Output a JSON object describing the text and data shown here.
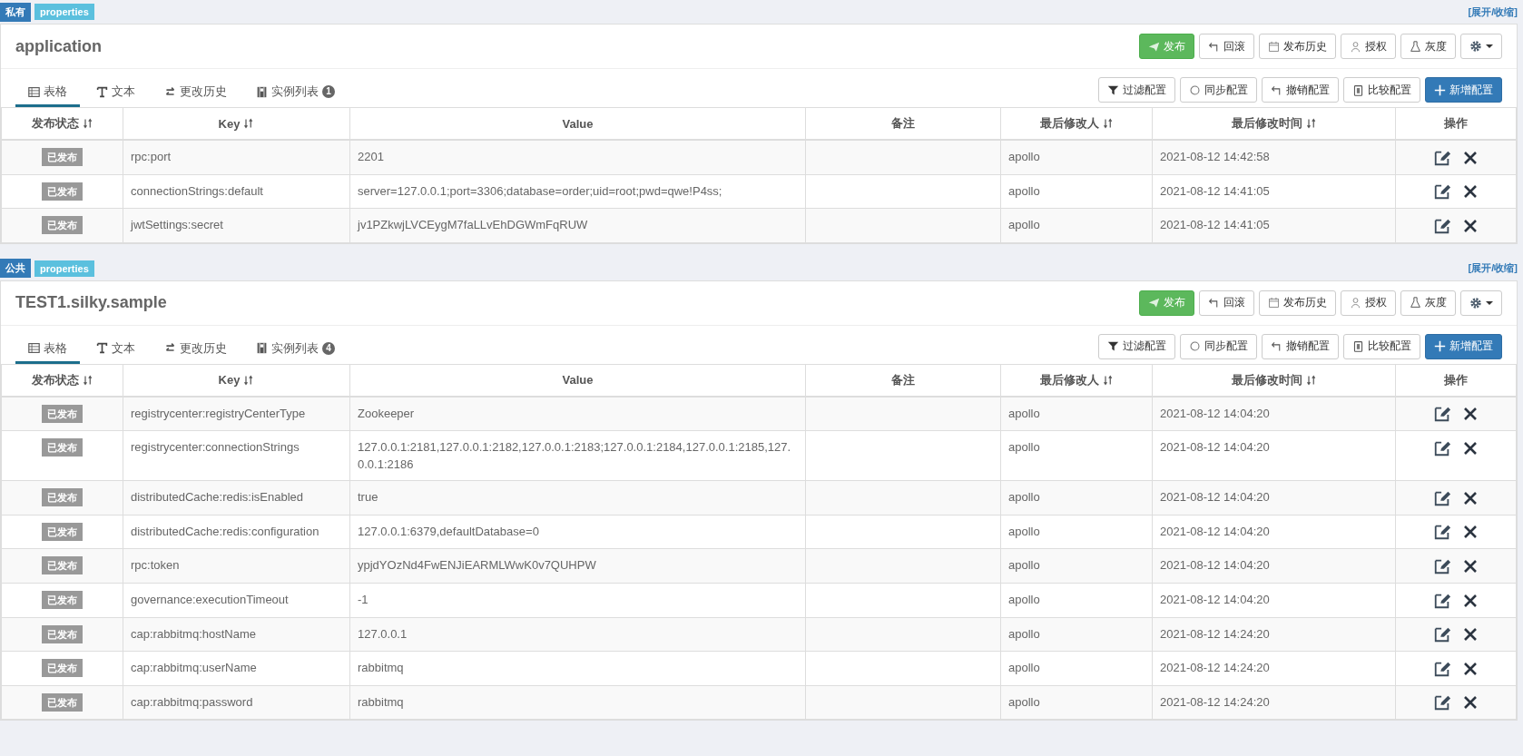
{
  "sections": [
    {
      "scope_badge": "私有",
      "format_badge": "properties",
      "toggle_link": "[展开/收缩]",
      "title": "application",
      "actions": [
        {
          "label": "发布",
          "kind": "publish"
        },
        {
          "label": "回滚",
          "kind": "rollback"
        },
        {
          "label": "发布历史",
          "kind": "history"
        },
        {
          "label": "授权",
          "kind": "grant"
        },
        {
          "label": "灰度",
          "kind": "canary"
        }
      ],
      "tabs": [
        {
          "label": "表格",
          "kind": "table",
          "selected": true
        },
        {
          "label": "文本",
          "kind": "text",
          "selected": false
        },
        {
          "label": "更改历史",
          "kind": "changes",
          "selected": false
        },
        {
          "label": "实例列表",
          "kind": "instances",
          "badge": "1",
          "selected": false
        }
      ],
      "table_actions": [
        {
          "label": "过滤配置",
          "kind": "filter"
        },
        {
          "label": "同步配置",
          "kind": "sync"
        },
        {
          "label": "撤销配置",
          "kind": "revoke"
        },
        {
          "label": "比较配置",
          "kind": "compare"
        },
        {
          "label": "新增配置",
          "kind": "add"
        }
      ],
      "columns": [
        {
          "label": "发布状态",
          "sortable": true
        },
        {
          "label": "Key",
          "sortable": true
        },
        {
          "label": "Value",
          "sortable": false
        },
        {
          "label": "备注",
          "sortable": false
        },
        {
          "label": "最后修改人",
          "sortable": true
        },
        {
          "label": "最后修改时间",
          "sortable": true
        },
        {
          "label": "操作",
          "sortable": false
        }
      ],
      "rows": [
        {
          "status": "已发布",
          "key": "rpc:port",
          "value": "2201",
          "modifier": "apollo",
          "time": "2021-08-12 14:42:58"
        },
        {
          "status": "已发布",
          "key": "connectionStrings:default",
          "value": "server=127.0.0.1;port=3306;database=order;uid=root;pwd=qwe!P4ss;",
          "modifier": "apollo",
          "time": "2021-08-12 14:41:05"
        },
        {
          "status": "已发布",
          "key": "jwtSettings:secret",
          "value": "jv1PZkwjLVCEygM7faLLvEhDGWmFqRUW",
          "modifier": "apollo",
          "time": "2021-08-12 14:41:05"
        }
      ]
    },
    {
      "scope_badge": "公共",
      "format_badge": "properties",
      "toggle_link": "[展开/收缩]",
      "title": "TEST1.silky.sample",
      "actions": [
        {
          "label": "发布",
          "kind": "publish"
        },
        {
          "label": "回滚",
          "kind": "rollback"
        },
        {
          "label": "发布历史",
          "kind": "history"
        },
        {
          "label": "授权",
          "kind": "grant"
        },
        {
          "label": "灰度",
          "kind": "canary"
        }
      ],
      "tabs": [
        {
          "label": "表格",
          "kind": "table",
          "selected": true
        },
        {
          "label": "文本",
          "kind": "text",
          "selected": false
        },
        {
          "label": "更改历史",
          "kind": "changes",
          "selected": false
        },
        {
          "label": "实例列表",
          "kind": "instances",
          "badge": "4",
          "selected": false
        }
      ],
      "table_actions": [
        {
          "label": "过滤配置",
          "kind": "filter"
        },
        {
          "label": "同步配置",
          "kind": "sync"
        },
        {
          "label": "撤销配置",
          "kind": "revoke"
        },
        {
          "label": "比较配置",
          "kind": "compare"
        },
        {
          "label": "新增配置",
          "kind": "add"
        }
      ],
      "columns": [
        {
          "label": "发布状态",
          "sortable": true
        },
        {
          "label": "Key",
          "sortable": true
        },
        {
          "label": "Value",
          "sortable": false
        },
        {
          "label": "备注",
          "sortable": false
        },
        {
          "label": "最后修改人",
          "sortable": true
        },
        {
          "label": "最后修改时间",
          "sortable": true
        },
        {
          "label": "操作",
          "sortable": false
        }
      ],
      "rows": [
        {
          "status": "已发布",
          "key": "registrycenter:registryCenterType",
          "value": "Zookeeper",
          "modifier": "apollo",
          "time": "2021-08-12 14:04:20"
        },
        {
          "status": "已发布",
          "key": "registrycenter:connectionStrings",
          "value": "127.0.0.1:2181,127.0.0.1:2182,127.0.0.1:2183;127.0.0.1:2184,127.0.0.1:2185,127.0.0.1:2186",
          "modifier": "apollo",
          "time": "2021-08-12 14:04:20"
        },
        {
          "status": "已发布",
          "key": "distributedCache:redis:isEnabled",
          "value": "true",
          "modifier": "apollo",
          "time": "2021-08-12 14:04:20"
        },
        {
          "status": "已发布",
          "key": "distributedCache:redis:configuration",
          "value": "127.0.0.1:6379,defaultDatabase=0",
          "modifier": "apollo",
          "time": "2021-08-12 14:04:20"
        },
        {
          "status": "已发布",
          "key": "rpc:token",
          "value": "ypjdYOzNd4FwENJiEARMLWwK0v7QUHPW",
          "modifier": "apollo",
          "time": "2021-08-12 14:04:20"
        },
        {
          "status": "已发布",
          "key": "governance:executionTimeout",
          "value": "-1",
          "modifier": "apollo",
          "time": "2021-08-12 14:04:20"
        },
        {
          "status": "已发布",
          "key": "cap:rabbitmq:hostName",
          "value": "127.0.0.1",
          "modifier": "apollo",
          "time": "2021-08-12 14:24:20"
        },
        {
          "status": "已发布",
          "key": "cap:rabbitmq:userName",
          "value": "rabbitmq",
          "modifier": "apollo",
          "time": "2021-08-12 14:24:20"
        },
        {
          "status": "已发布",
          "key": "cap:rabbitmq:password",
          "value": "rabbitmq",
          "modifier": "apollo",
          "time": "2021-08-12 14:24:20"
        }
      ]
    }
  ]
}
